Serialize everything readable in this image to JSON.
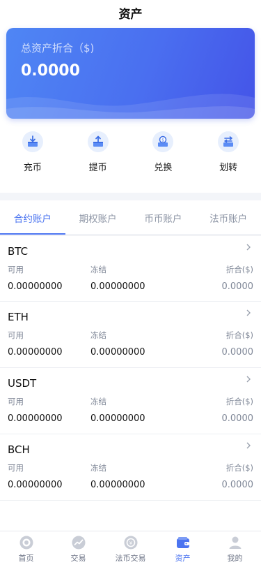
{
  "header": {
    "title": "资产"
  },
  "balance": {
    "label": "总资产折合（$)",
    "value": "0.0000"
  },
  "actions": [
    {
      "label": "充币",
      "icon": "deposit-icon"
    },
    {
      "label": "提币",
      "icon": "withdraw-icon"
    },
    {
      "label": "兑换",
      "icon": "exchange-icon"
    },
    {
      "label": "划转",
      "icon": "transfer-icon"
    }
  ],
  "tabs": [
    {
      "label": "合约账户",
      "active": true
    },
    {
      "label": "期权账户",
      "active": false
    },
    {
      "label": "币币账户",
      "active": false
    },
    {
      "label": "法币账户",
      "active": false
    }
  ],
  "columns": {
    "available": "可用",
    "frozen": "冻结",
    "converted": "折合($)"
  },
  "assets": [
    {
      "name": "BTC",
      "available": "0.00000000",
      "frozen": "0.00000000",
      "converted": "0.0000"
    },
    {
      "name": "ETH",
      "available": "0.00000000",
      "frozen": "0.00000000",
      "converted": "0.0000"
    },
    {
      "name": "USDT",
      "available": "0.00000000",
      "frozen": "0.00000000",
      "converted": "0.0000"
    },
    {
      "name": "BCH",
      "available": "0.00000000",
      "frozen": "0.00000000",
      "converted": "0.0000"
    }
  ],
  "nav": [
    {
      "label": "首页",
      "icon": "home-icon",
      "active": false
    },
    {
      "label": "交易",
      "icon": "trade-chart-icon",
      "active": false
    },
    {
      "label": "法币交易",
      "icon": "fiat-trade-icon",
      "active": false
    },
    {
      "label": "资产",
      "icon": "wallet-icon",
      "active": true
    },
    {
      "label": "我的",
      "icon": "profile-icon",
      "active": false
    }
  ],
  "colors": {
    "accent": "#4b74f0",
    "card_gradient_start": "#4f86f4",
    "card_gradient_end": "#4454e8",
    "muted": "#7f8797"
  }
}
